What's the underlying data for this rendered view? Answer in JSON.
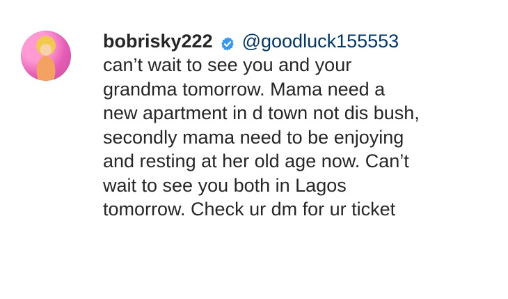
{
  "comment": {
    "username": "bobrisky222",
    "verified": true,
    "mention": "@goodluck155553",
    "lines": [
      "can’t wait to see you and your",
      "grandma tomorrow. Mama need a",
      "new apartment in d town not dis bush,",
      "secondly mama need to be enjoying",
      "and resting at her old age now. Can’t",
      "wait to see you both in Lagos",
      "tomorrow. Check ur dm for ur ticket"
    ],
    "colors": {
      "text": "#262626",
      "mention": "#00376b",
      "verified_badge": "#3897f0"
    },
    "icons": {
      "verified": "verified-badge-icon",
      "avatar": "avatar"
    }
  }
}
